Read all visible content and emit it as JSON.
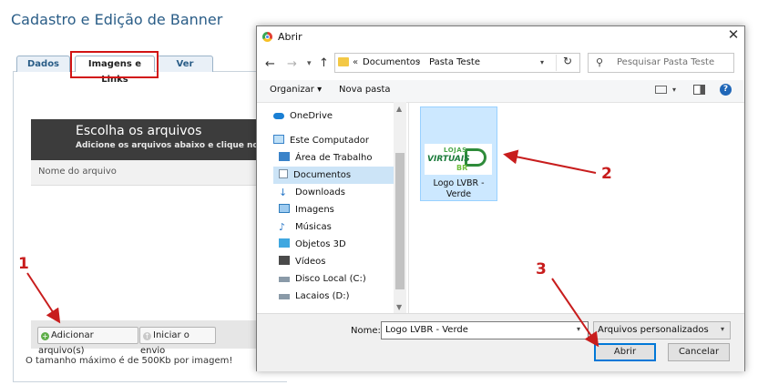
{
  "page": {
    "title": "Cadastro e Edição de Banner",
    "tabs": [
      "Dados",
      "Imagens e Links",
      "Ver"
    ],
    "uploader": {
      "title": "Escolha os arquivos",
      "subtitle": "Adicione os arquivos abaixo e clique no botão",
      "column_header": "Nome do arquivo",
      "add_button": "Adicionar arquivo(s)",
      "start_button": "Iniciar o envio",
      "max_size_note": "O tamanho máximo é de 500Kb por imagem!"
    }
  },
  "dialog": {
    "title": "Abrir",
    "address": {
      "prefix": "«",
      "crumbs": [
        "Documentos",
        "Pasta Teste"
      ]
    },
    "search_placeholder": "Pesquisar Pasta Teste",
    "toolbar": {
      "organize": "Organizar ▾",
      "new_folder": "Nova pasta"
    },
    "nav_tree": [
      {
        "label": "OneDrive",
        "icon": "cloud-icon"
      },
      {
        "label": "Este Computador",
        "icon": "computer-icon"
      },
      {
        "label": "Área de Trabalho",
        "icon": "desktop-icon"
      },
      {
        "label": "Documentos",
        "icon": "document-icon",
        "selected": true
      },
      {
        "label": "Downloads",
        "icon": "download-icon"
      },
      {
        "label": "Imagens",
        "icon": "image-icon"
      },
      {
        "label": "Músicas",
        "icon": "music-icon"
      },
      {
        "label": "Objetos 3D",
        "icon": "cube-icon"
      },
      {
        "label": "Vídeos",
        "icon": "video-icon"
      },
      {
        "label": "Disco Local (C:)",
        "icon": "drive-icon"
      },
      {
        "label": "Lacaios (D:)",
        "icon": "drive-icon"
      }
    ],
    "file": {
      "name": "Logo LVBR - Verde",
      "thumbnail_text": {
        "line1": "LOJAS",
        "line2": "VIRTUAIS",
        "line3": "BR"
      }
    },
    "filename_label": "Nome:",
    "filename_value": "Logo LVBR - Verde",
    "filetype_value": "Arquivos personalizados",
    "open_button": "Abrir",
    "cancel_button": "Cancelar"
  },
  "annotations": [
    "1",
    "2",
    "3"
  ],
  "colors": {
    "annotation": "#c81d1d",
    "accent": "#0078d7",
    "selection": "#cce8ff"
  }
}
